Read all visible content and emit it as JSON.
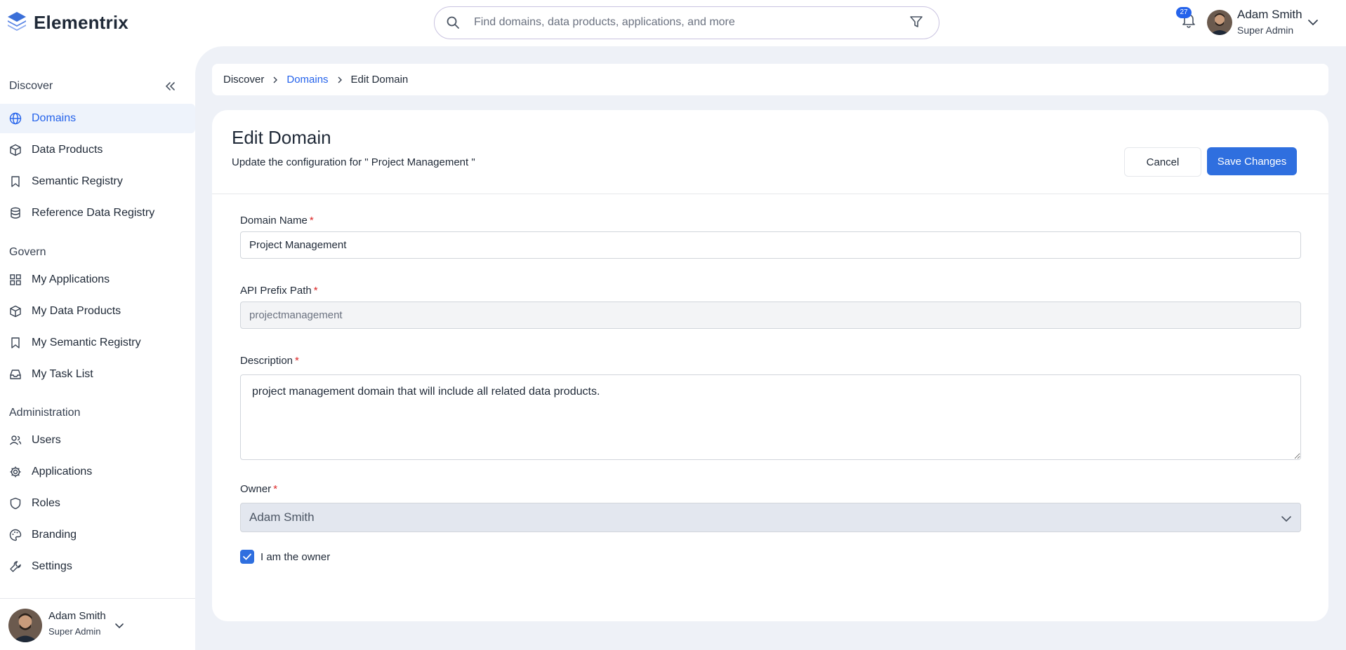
{
  "app": {
    "name": "Elementrix",
    "logo_icon": "layers-icon"
  },
  "search": {
    "placeholder": "Find domains, data products, applications, and more"
  },
  "notifications": {
    "count": "27"
  },
  "user": {
    "name": "Adam Smith",
    "role": "Super Admin"
  },
  "sidebar": {
    "sections": [
      {
        "title": "Discover",
        "items": [
          {
            "label": "Domains",
            "icon": "globe-icon",
            "active": true
          },
          {
            "label": "Data Products",
            "icon": "cube-icon"
          },
          {
            "label": "Semantic Registry",
            "icon": "bookmark-icon"
          },
          {
            "label": "Reference Data Registry",
            "icon": "database-icon"
          }
        ]
      },
      {
        "title": "Govern",
        "items": [
          {
            "label": "My Applications",
            "icon": "grid-icon"
          },
          {
            "label": "My Data Products",
            "icon": "cube-icon"
          },
          {
            "label": "My Semantic Registry",
            "icon": "bookmark-icon"
          },
          {
            "label": "My Task List",
            "icon": "inbox-icon"
          }
        ]
      },
      {
        "title": "Administration",
        "items": [
          {
            "label": "Users",
            "icon": "users-icon"
          },
          {
            "label": "Applications",
            "icon": "gear-icon"
          },
          {
            "label": "Roles",
            "icon": "shield-icon"
          },
          {
            "label": "Branding",
            "icon": "palette-icon"
          },
          {
            "label": "Settings",
            "icon": "wrench-icon"
          }
        ]
      }
    ]
  },
  "breadcrumb": {
    "items": [
      "Discover",
      "Domains",
      "Edit Domain"
    ]
  },
  "form": {
    "title": "Edit Domain",
    "subtitle": "Update the configuration for \" Project Management \"",
    "cancel_label": "Cancel",
    "save_label": "Save Changes",
    "domain_name": {
      "label": "Domain Name",
      "value": "Project Management"
    },
    "api_prefix": {
      "label": "API Prefix Path",
      "value": "projectmanagement"
    },
    "description": {
      "label": "Description",
      "value": "project management domain that will include all related data products."
    },
    "owner": {
      "label": "Owner",
      "value": "Adam Smith"
    },
    "owner_checkbox": {
      "label": "I am the owner",
      "checked": true
    },
    "required_mark": "*"
  }
}
